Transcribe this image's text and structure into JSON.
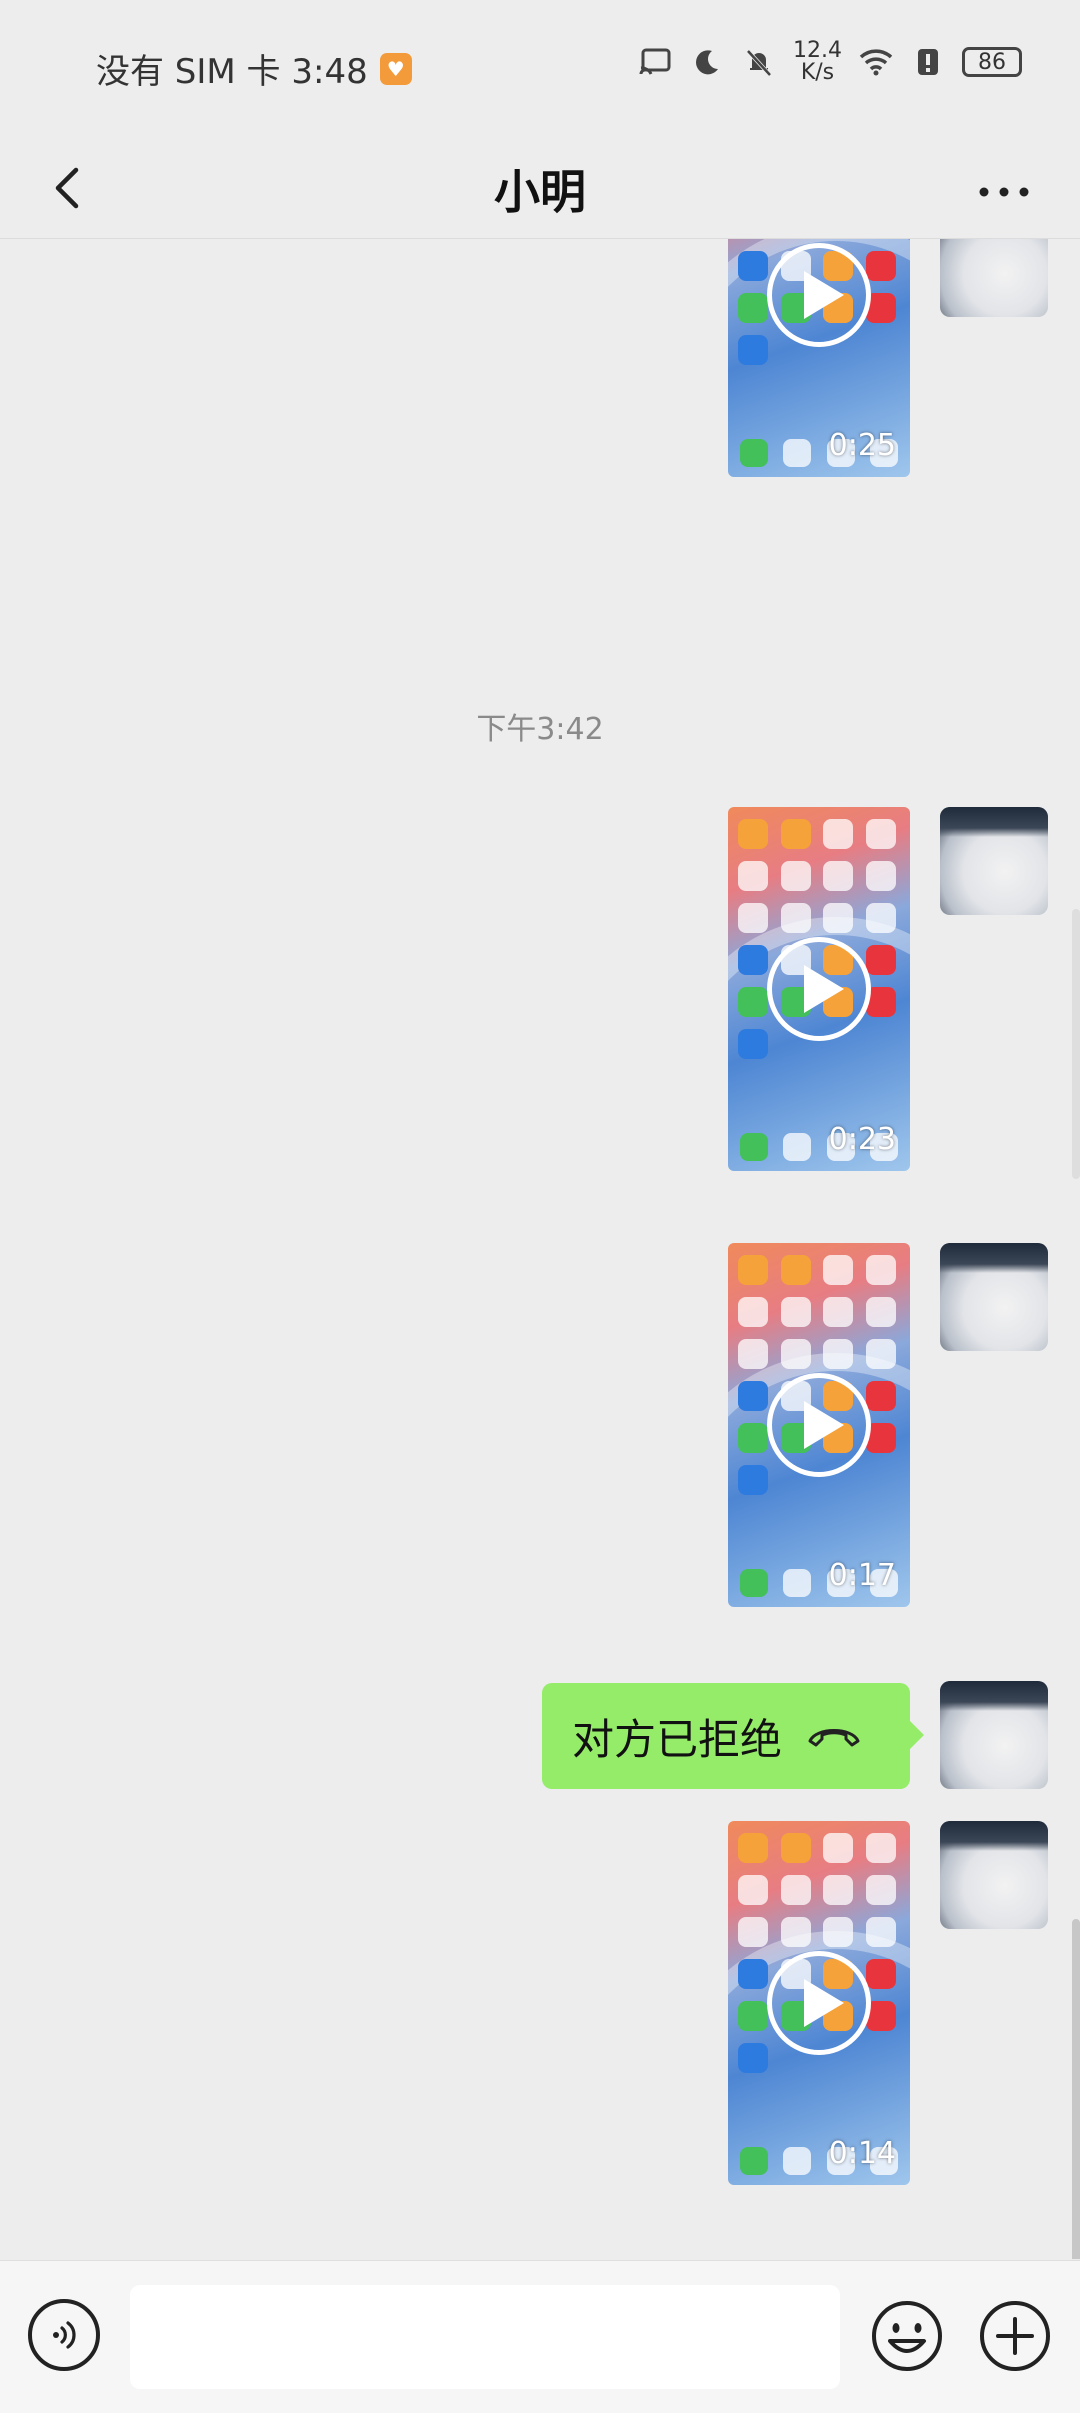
{
  "status_bar": {
    "carrier_time": "没有 SIM 卡 3:48",
    "net_speed_value": "12.4",
    "net_speed_unit": "K/s",
    "battery": "86",
    "icons": [
      "cast-icon",
      "moon-icon",
      "bell-off-icon",
      "wifi-icon",
      "alert-icon",
      "battery-icon"
    ]
  },
  "header": {
    "title": "小明",
    "back_icon": "chevron-left-icon",
    "more_icon": "more-dots-icon"
  },
  "messages": [
    {
      "type": "video",
      "duration": "0:25",
      "sender": "me"
    },
    {
      "type": "timestamp",
      "text": "下午3:42"
    },
    {
      "type": "video",
      "duration": "0:23",
      "sender": "me"
    },
    {
      "type": "video",
      "duration": "0:17",
      "sender": "me"
    },
    {
      "type": "call",
      "text": "对方已拒绝",
      "icon": "hangup-icon",
      "sender": "me"
    },
    {
      "type": "video",
      "duration": "0:14",
      "sender": "me"
    }
  ],
  "input_bar": {
    "voice_icon": "voice-icon",
    "placeholder": "",
    "emoji_icon": "emoji-icon",
    "plus_icon": "plus-icon"
  },
  "colors": {
    "background": "#ededed",
    "bubble_green": "#95ec69",
    "timestamp_gray": "#8a8a8a"
  }
}
